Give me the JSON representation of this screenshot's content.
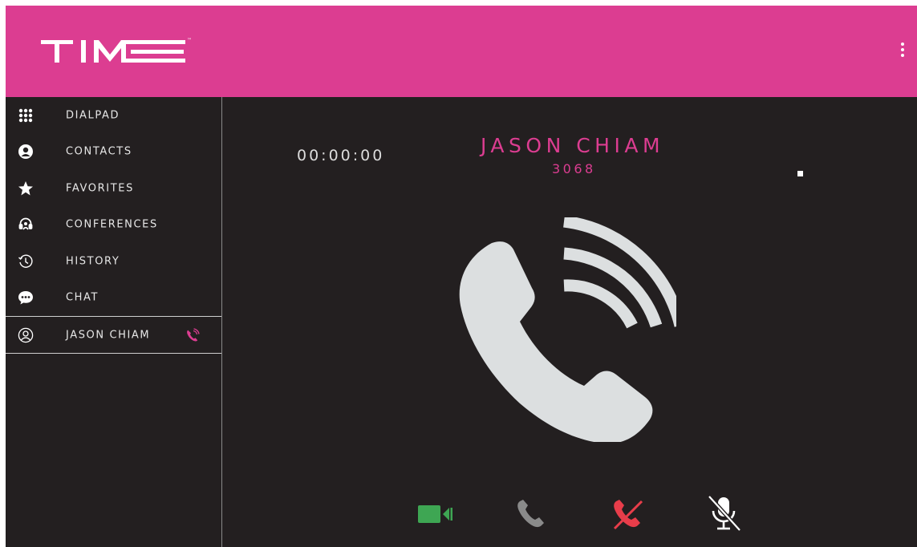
{
  "header": {
    "logo_text": "TIME",
    "trademark": "™",
    "menu_icon": "more-vertical-icon",
    "colors": {
      "header_bg": "#dc3d91",
      "logo_fg": "#ffffff"
    }
  },
  "sidebar": {
    "items": [
      {
        "label": "DIALPAD",
        "icon": "dialpad-grid-icon"
      },
      {
        "label": "CONTACTS",
        "icon": "contact-person-icon"
      },
      {
        "label": "FAVORITES",
        "icon": "star-icon"
      },
      {
        "label": "CONFERENCES",
        "icon": "conference-headset-icon"
      },
      {
        "label": "HISTORY",
        "icon": "history-clock-icon"
      },
      {
        "label": "CHAT",
        "icon": "chat-bubble-icon"
      }
    ],
    "active_call": {
      "label": "JASON CHIAM",
      "icon": "contact-outline-icon",
      "status_icon": "ringing-phone-icon"
    }
  },
  "call": {
    "timer": "00:00:00",
    "caller_name": "JASON CHIAM",
    "caller_number": "3068",
    "hero_icon": "ringing-phone-icon",
    "colors": {
      "accent": "#dc3d91",
      "phone_icon": "#dcdfe0",
      "bg": "#231f20"
    }
  },
  "controls": {
    "video": {
      "icon": "video-camera-icon",
      "color": "#3ea653"
    },
    "answer": {
      "icon": "phone-icon",
      "color": "#8a8a8a"
    },
    "hangup": {
      "icon": "hangup-phone-icon",
      "color": "#e83d4a"
    },
    "mute": {
      "icon": "microphone-muted-icon",
      "color": "#ffffff"
    }
  }
}
